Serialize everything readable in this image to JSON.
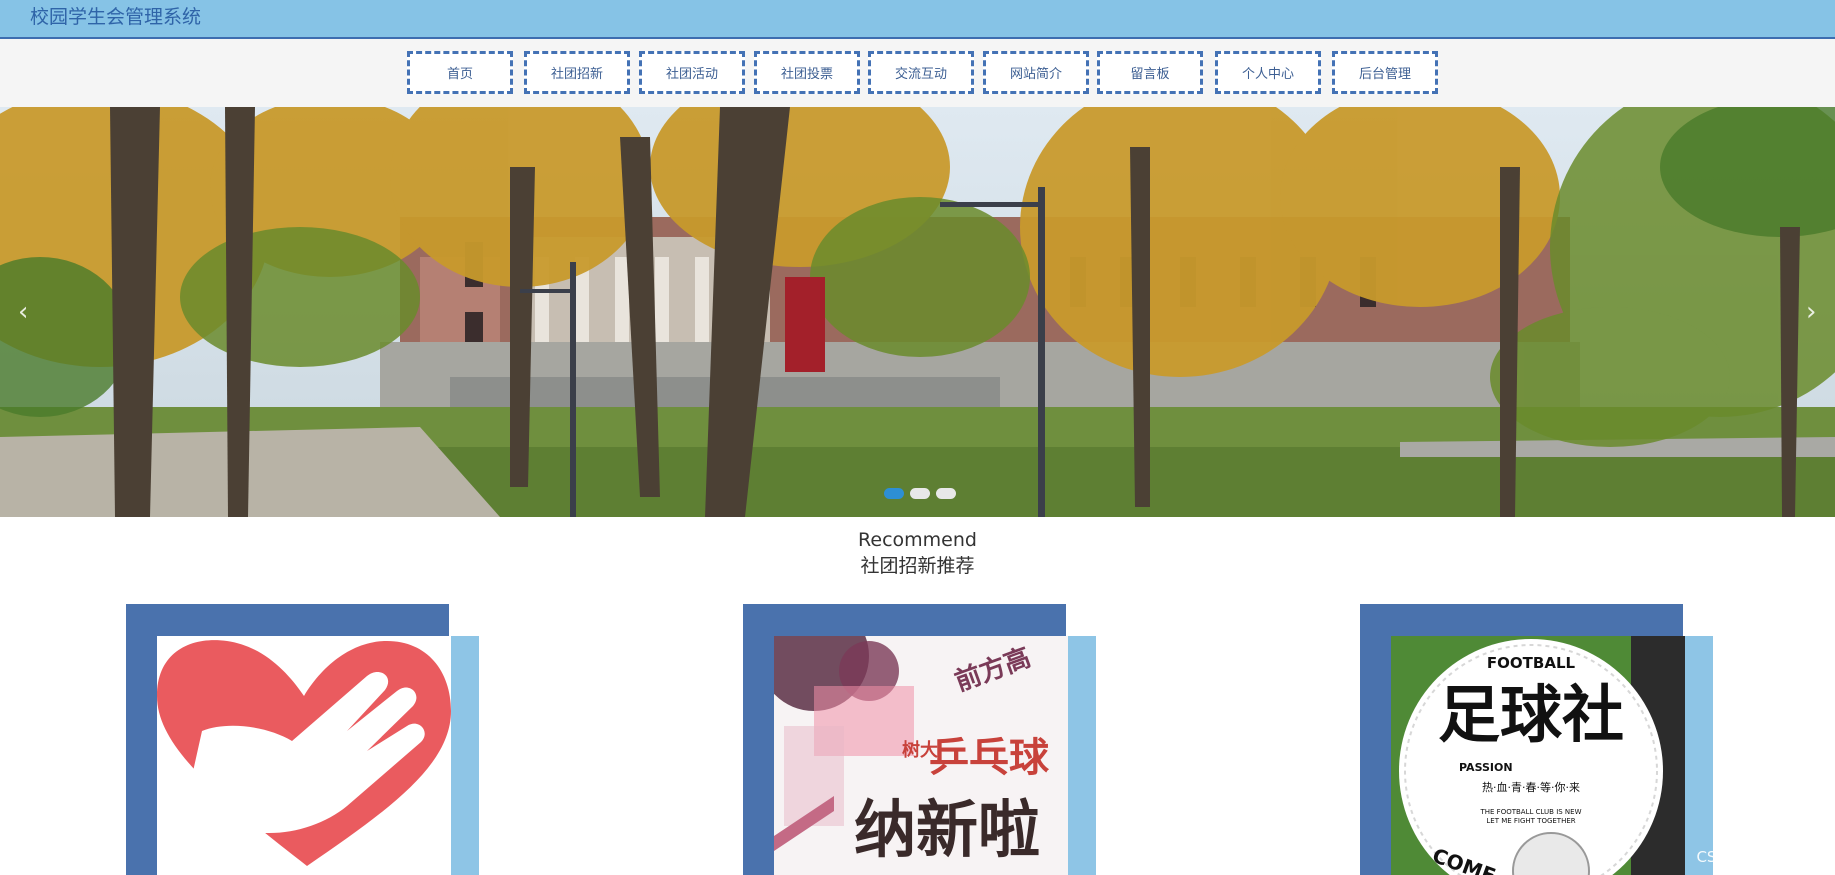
{
  "header": {
    "title": "校园学生会管理系统"
  },
  "nav": {
    "items": [
      {
        "label": "首页"
      },
      {
        "label": "社团招新"
      },
      {
        "label": "社团活动"
      },
      {
        "label": "社团投票"
      },
      {
        "label": "交流互动"
      },
      {
        "label": "网站简介"
      },
      {
        "label": "留言板"
      },
      {
        "label": "个人中心"
      },
      {
        "label": "后台管理"
      }
    ]
  },
  "banner": {
    "prev_icon": "chevron-left-icon",
    "next_icon": "chevron-right-icon",
    "prev_glyph": "‹",
    "next_glyph": "›",
    "slide_count": 3,
    "active_slide": 1
  },
  "recommend": {
    "title_en": "Recommend",
    "title_zh": "社团招新推荐",
    "cards": [
      {
        "image_icon": "volunteer-heart-hand-icon"
      },
      {
        "image_icon": "table-tennis-poster-icon",
        "poster_text": "乒乓球",
        "poster_sub": "纳新啦",
        "poster_top": "前方高",
        "poster_side": "树大"
      },
      {
        "image_icon": "football-club-poster-icon",
        "poster_title": "FOOTBALL",
        "poster_main": "足球社",
        "poster_passion": "PASSION",
        "poster_slogan": "热·血·青·春·等·你·来",
        "poster_en1": "THE FOOTBALL CLUB IS NEW",
        "poster_en2": "LET ME FIGHT TOGETHER",
        "poster_come": "COME"
      }
    ]
  },
  "watermark": {
    "text": "CSDN @阿达学长"
  },
  "colors": {
    "topbar": "#86c3e6",
    "nav_border": "#4472b5",
    "card_frame": "#4a72ad",
    "card_strip": "#8ec5e6"
  }
}
